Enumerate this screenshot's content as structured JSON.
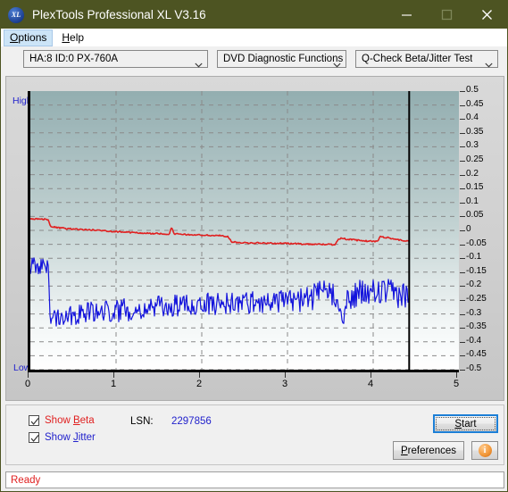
{
  "window": {
    "title": "PlexTools Professional XL V3.16",
    "icon": "xl-logo-icon",
    "minimize": "minimize-icon",
    "maximize": "maximize-icon",
    "close": "close-icon"
  },
  "menubar": {
    "items": [
      {
        "label": "Options",
        "accel": "O",
        "active": true
      },
      {
        "label": "Help",
        "accel": "H",
        "active": false
      }
    ]
  },
  "selectors": {
    "drive": {
      "value": "HA:8 ID:0  PX-760A"
    },
    "function": {
      "value": "DVD Diagnostic Functions"
    },
    "test": {
      "value": "Q-Check Beta/Jitter Test"
    }
  },
  "chart": {
    "axis_label_high": "High",
    "axis_label_low": "Low"
  },
  "controls": {
    "show_beta": {
      "label_pre": "Show ",
      "accel": "B",
      "label_post": "eta",
      "checked": true
    },
    "show_jitter": {
      "label_pre": "Show ",
      "accel": "J",
      "label_post": "itter",
      "checked": true
    },
    "lsn_label": "LSN:",
    "lsn_value": "2297856",
    "start": {
      "pre": "",
      "accel": "S",
      "post": "tart"
    },
    "preferences": {
      "pre": "",
      "accel": "P",
      "post": "references"
    },
    "info": "info-icon"
  },
  "statusbar": {
    "text": "Ready"
  },
  "colors": {
    "titlebar": "#4d5422",
    "beta_trace": "#e02020",
    "jitter_trace": "#1414dc",
    "accent_blue": "#2222cc",
    "status_text": "#e02020",
    "focus_border": "#1c7fd6"
  },
  "chart_data": {
    "type": "line",
    "title": "Q-Check Beta/Jitter Test",
    "xlabel": "",
    "ylabel": "",
    "xlim": [
      0,
      5
    ],
    "ylim": [
      -0.5,
      0.5
    ],
    "grid": true,
    "legend": "none",
    "xticks": [
      0,
      1,
      2,
      3,
      4,
      5
    ],
    "yticks": [
      0.5,
      0.45,
      0.4,
      0.35,
      0.3,
      0.25,
      0.2,
      0.15,
      0.1,
      0.05,
      0,
      -0.05,
      -0.1,
      -0.15,
      -0.2,
      -0.25,
      -0.3,
      -0.35,
      -0.4,
      -0.45,
      -0.5
    ],
    "xtick_labels": [
      "0",
      "1",
      "2",
      "3",
      "4",
      "5"
    ],
    "ytick_labels": [
      "0.5",
      "0.45",
      "0.4",
      "0.35",
      "0.3",
      "0.25",
      "0.2",
      "0.15",
      "0.1",
      "0.05",
      "0",
      "-0.05",
      "-0.1",
      "-0.15",
      "-0.2",
      "-0.25",
      "-0.3",
      "-0.35",
      "-0.4",
      "-0.45",
      "-0.5"
    ],
    "data_end_x": 4.42,
    "annotations": [
      {
        "kind": "vertical-marker",
        "x": 4.42,
        "color": "#000000"
      },
      {
        "kind": "axis-text",
        "text": "High",
        "position": "top-left",
        "color": "#2222cc"
      },
      {
        "kind": "axis-text",
        "text": "Low",
        "position": "bottom-left",
        "color": "#2222cc"
      }
    ],
    "series": [
      {
        "name": "Beta",
        "color": "#e02020",
        "x": [
          0.02,
          0.06,
          0.1,
          0.14,
          0.18,
          0.21,
          0.23,
          0.26,
          0.3,
          0.4,
          0.55,
          0.75,
          1.0,
          1.25,
          1.5,
          1.62,
          1.65,
          1.68,
          1.8,
          2.0,
          2.2,
          2.3,
          2.35,
          2.45,
          2.6,
          2.8,
          3.0,
          3.2,
          3.4,
          3.55,
          3.6,
          3.63,
          3.7,
          3.9,
          4.05,
          4.08,
          4.12,
          4.2,
          4.3,
          4.42
        ],
        "y": [
          0.04,
          0.041,
          0.039,
          0.04,
          0.041,
          0.038,
          0.016,
          0.013,
          0.01,
          0.007,
          0.004,
          0.001,
          -0.004,
          -0.009,
          -0.012,
          -0.013,
          0.012,
          -0.013,
          -0.015,
          -0.017,
          -0.019,
          -0.021,
          -0.042,
          -0.044,
          -0.045,
          -0.046,
          -0.047,
          -0.049,
          -0.05,
          -0.051,
          -0.03,
          -0.028,
          -0.032,
          -0.038,
          -0.04,
          -0.022,
          -0.024,
          -0.028,
          -0.034,
          -0.04
        ]
      },
      {
        "name": "Jitter",
        "color": "#1414dc",
        "noise_band": true,
        "x": [
          0.02,
          0.06,
          0.1,
          0.14,
          0.18,
          0.21,
          0.23,
          0.3,
          0.45,
          0.6,
          0.8,
          1.0,
          1.2,
          1.4,
          1.6,
          1.8,
          2.0,
          2.2,
          2.4,
          2.6,
          2.8,
          3.0,
          3.2,
          3.4,
          3.55,
          3.6,
          3.65,
          3.72,
          3.8,
          3.95,
          4.1,
          4.25,
          4.42
        ],
        "y": [
          -0.13,
          -0.128,
          -0.133,
          -0.129,
          -0.134,
          -0.131,
          -0.3,
          -0.305,
          -0.3,
          -0.296,
          -0.292,
          -0.288,
          -0.283,
          -0.278,
          -0.273,
          -0.27,
          -0.266,
          -0.262,
          -0.26,
          -0.258,
          -0.256,
          -0.254,
          -0.248,
          -0.23,
          -0.222,
          -0.27,
          -0.3,
          -0.245,
          -0.232,
          -0.225,
          -0.222,
          -0.228,
          -0.232
        ],
        "amplitude": [
          0.03,
          0.03,
          0.032,
          0.03,
          0.031,
          0.03,
          0.045,
          0.042,
          0.04,
          0.04,
          0.04,
          0.042,
          0.041,
          0.04,
          0.04,
          0.041,
          0.04,
          0.042,
          0.041,
          0.04,
          0.04,
          0.042,
          0.046,
          0.05,
          0.048,
          0.042,
          0.04,
          0.05,
          0.052,
          0.05,
          0.05,
          0.05,
          0.048
        ]
      }
    ]
  }
}
